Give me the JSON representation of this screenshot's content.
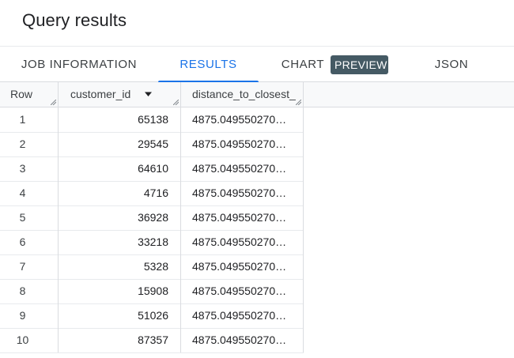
{
  "page": {
    "title": "Query results"
  },
  "tabs": [
    {
      "label": "JOB INFORMATION"
    },
    {
      "label": "RESULTS",
      "active": true
    },
    {
      "label": "CHART",
      "badge": "PREVIEW"
    },
    {
      "label": "JSON"
    }
  ],
  "table": {
    "columns": [
      {
        "label": "Row"
      },
      {
        "label": "customer_id",
        "sort": "descending"
      },
      {
        "label": "distance_to_closest_"
      }
    ],
    "rows": [
      {
        "row": "1",
        "customer_id": "65138",
        "distance": "4875.049550270…"
      },
      {
        "row": "2",
        "customer_id": "29545",
        "distance": "4875.049550270…"
      },
      {
        "row": "3",
        "customer_id": "64610",
        "distance": "4875.049550270…"
      },
      {
        "row": "4",
        "customer_id": "4716",
        "distance": "4875.049550270…"
      },
      {
        "row": "5",
        "customer_id": "36928",
        "distance": "4875.049550270…"
      },
      {
        "row": "6",
        "customer_id": "33218",
        "distance": "4875.049550270…"
      },
      {
        "row": "7",
        "customer_id": "5328",
        "distance": "4875.049550270…"
      },
      {
        "row": "8",
        "customer_id": "15908",
        "distance": "4875.049550270…"
      },
      {
        "row": "9",
        "customer_id": "51026",
        "distance": "4875.049550270…"
      },
      {
        "row": "10",
        "customer_id": "87357",
        "distance": "4875.049550270…"
      }
    ]
  },
  "colors": {
    "accent": "#1a73e8",
    "badge_bg": "#455a64",
    "divider": "#dadce0",
    "text": "#202124"
  },
  "icons": {
    "sort": "sort-descending-icon",
    "resize": "column-resize-handle-icon"
  }
}
